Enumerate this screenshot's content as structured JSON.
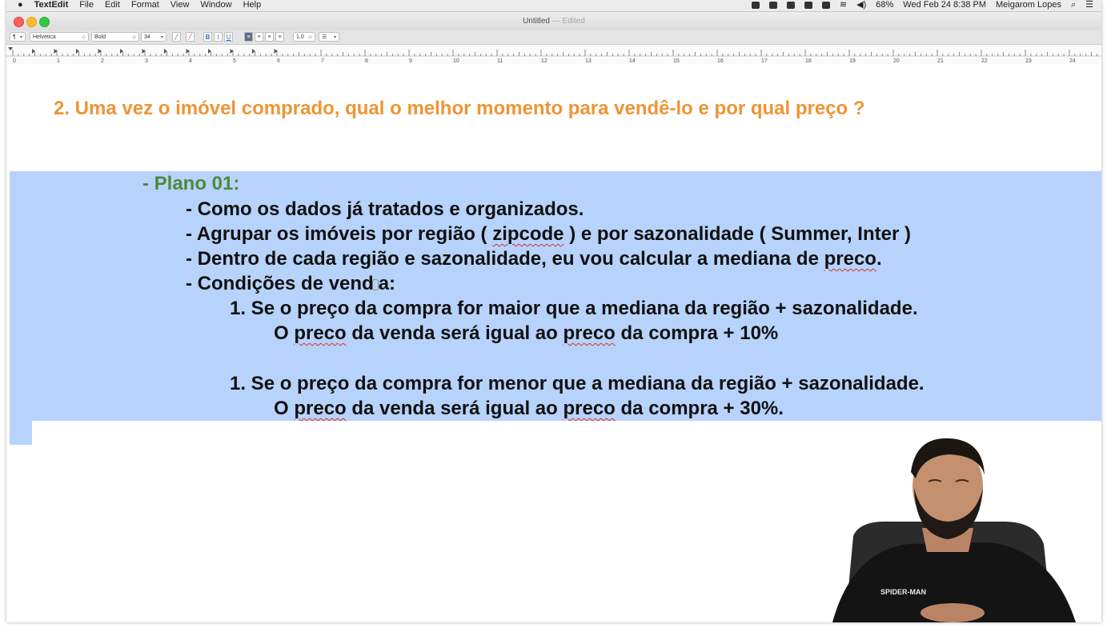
{
  "menubar": {
    "app_name": "TextEdit",
    "menus": [
      "File",
      "Edit",
      "Format",
      "View",
      "Window",
      "Help"
    ],
    "battery": "68%",
    "datetime": "Wed Feb 24  8:38 PM",
    "user": "Meigarom Lopes"
  },
  "window": {
    "title": "Untitled",
    "edited": "— Edited"
  },
  "toolbar": {
    "paragraph_style": "¶",
    "font_family": "Helvetica",
    "font_style": "Bold",
    "font_size": "34",
    "bold": "B",
    "italic": "I",
    "underline": "U",
    "line_spacing": "1.0",
    "list": "☰"
  },
  "ruler": {
    "marks": [
      "0",
      "1",
      "2",
      "3",
      "4",
      "5",
      "6",
      "7",
      "8",
      "9",
      "10",
      "11",
      "12",
      "13",
      "14",
      "15",
      "16",
      "17",
      "18",
      "19",
      "20",
      "21",
      "22",
      "23",
      "24"
    ]
  },
  "document": {
    "heading": "2. Uma vez o imóvel comprado, qual o melhor momento para vendê-lo e por qual preço ?",
    "plan_title": "- Plano 01:",
    "line1": "- Como os dados já tratados e organizados.",
    "line2_a": "- Agrupar os imóveis por região ( ",
    "line2_b": "zipcode",
    "line2_c": " ) e por sazonalidade ( Summer, Inter )",
    "line3_a": "- Dentro de cada região e sazonalidade, eu vou calcular a mediana de ",
    "line3_b": "preco",
    "line3_c": ".",
    "line4_a": "- Condições de vend",
    "line4_b": "a:",
    "rule1": "1. Se o preço da compra for maior que a mediana da região + sazonalidade.",
    "result1_a": "O ",
    "result1_b": "preco",
    "result1_c": " da venda será igual ao ",
    "result1_d": "preco",
    "result1_e": " da compra + 10%",
    "rule2": "1. Se o preço da compra for menor que a mediana da região + sazonalidade.",
    "result2_a": "O ",
    "result2_b": "preco",
    "result2_c": " da venda será igual ao ",
    "result2_d": "preco",
    "result2_e": " da compra + 30%."
  },
  "colors": {
    "heading": "#ef9434",
    "plan": "#4d8a3a",
    "selection": "#b7d3fb"
  },
  "webcam": {
    "shirt_text": "SPIDER-MAN"
  }
}
